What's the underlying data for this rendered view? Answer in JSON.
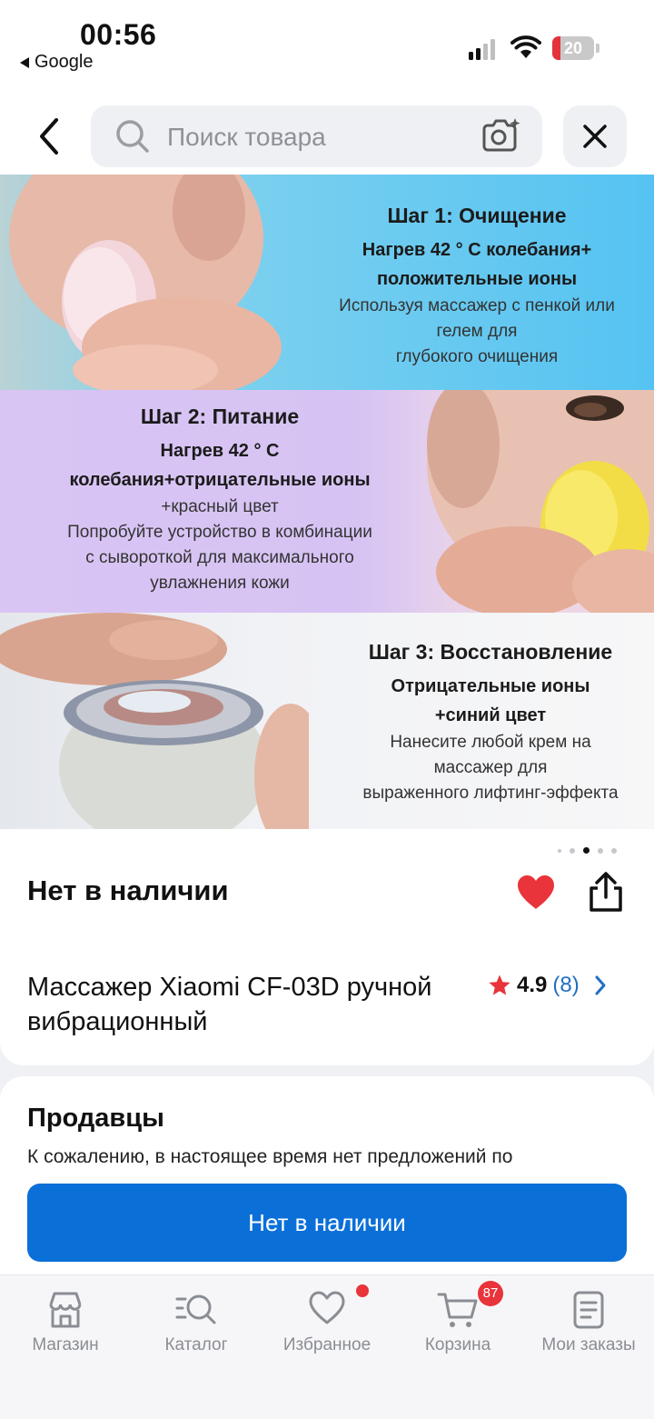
{
  "status_bar": {
    "time": "00:56",
    "back_app": "Google",
    "battery_level": "20",
    "battery_fraction": 0.2
  },
  "header": {
    "search_placeholder": "Поиск товара"
  },
  "banner": {
    "step1": {
      "title": "Шаг 1: Очищение",
      "sub1": "Нагрев 42 ° С колебания+",
      "sub2": "положительные ионы",
      "desc1": "Используя массажер с пенкой или",
      "desc2": "гелем для",
      "desc3": "глубокого очищения"
    },
    "step2": {
      "title": "Шаг 2: Питание",
      "sub1": "Нагрев 42 ° С",
      "sub2": "колебания+отрицательные ионы",
      "desc1": "+красный цвет",
      "desc2": "Попробуйте устройство в комбинации",
      "desc3": "с сывороткой для максимального",
      "desc4": "увлажнения кожи"
    },
    "step3": {
      "title": "Шаг 3: Восстановление",
      "sub1": "Отрицательные ионы",
      "sub2": "+синий цвет",
      "desc1": "Нанесите любой крем на",
      "desc2": "массажер для",
      "desc3": "выраженного лифтинг-эффекта"
    }
  },
  "product": {
    "availability": "Нет в наличии",
    "title": "Массажер Xiaomi CF-03D ручной вибрационный",
    "rating": "4.9",
    "reviews": "(8)"
  },
  "sellers": {
    "heading": "Продавцы",
    "message": "К сожалению, в настоящее время нет предложений по",
    "cta": "Нет в наличии"
  },
  "nav": {
    "items": [
      {
        "label": "Магазин",
        "icon": "shop-icon"
      },
      {
        "label": "Каталог",
        "icon": "catalog-icon"
      },
      {
        "label": "Избранное",
        "icon": "heart-icon"
      },
      {
        "label": "Корзина",
        "icon": "cart-icon"
      },
      {
        "label": "Мои заказы",
        "icon": "orders-icon"
      }
    ],
    "cart_badge": "87"
  },
  "colors": {
    "accent": "#0b6fd8",
    "favorite": "#e8343a",
    "rating_count": "#1f6fc4"
  }
}
